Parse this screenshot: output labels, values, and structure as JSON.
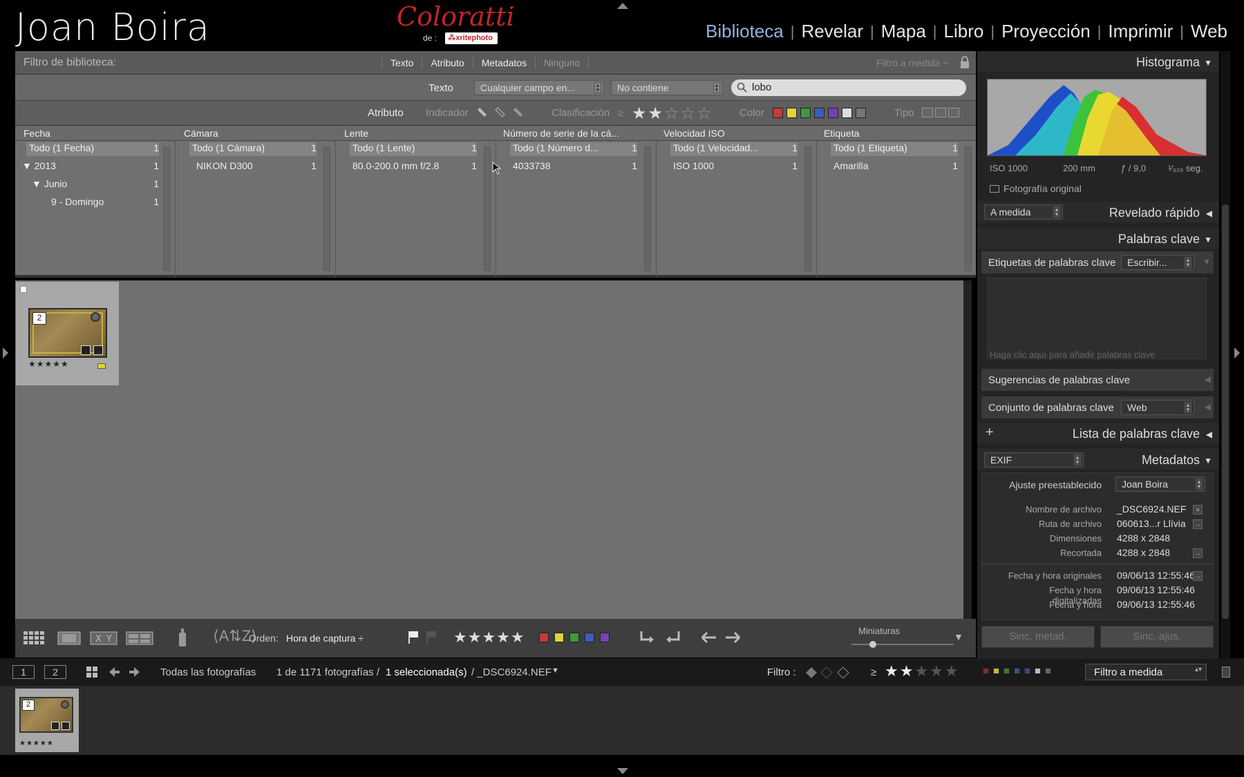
{
  "identity_plate": "Joan Boira",
  "brand": {
    "script": "Coloratti",
    "by": "de :",
    "xrite": "⁂xritephoto"
  },
  "modules": [
    "Biblioteca",
    "Revelar",
    "Mapa",
    "Libro",
    "Proyección",
    "Imprimir",
    "Web"
  ],
  "filter": {
    "title": "Filtro de biblioteca:",
    "tabs": [
      "Texto",
      "Atributo",
      "Metadatos",
      "Ninguno"
    ],
    "custom": "Filtro a medida ÷",
    "text_label": "Texto",
    "field_select": "Cualquier campo en...",
    "rule_select": "No contiene",
    "search_value": "lobo",
    "attr_label": "Atributo",
    "indicator_label": "Indicador",
    "rating_label": "Clasificación",
    "rating_op": "≥",
    "color_label": "Color",
    "type_label": "Tipo",
    "colors": [
      "#c53a3a",
      "#e0d43a",
      "#3c9a3c",
      "#3a5fb8",
      "#7a3fb8",
      "#dddddd",
      "#777777"
    ]
  },
  "columns": [
    {
      "head": "Fecha",
      "rows": [
        {
          "label": "Todo (1 Fecha)",
          "count": "1"
        },
        {
          "label": "▼ 2013",
          "count": "1"
        },
        {
          "label": "▼ Junio",
          "count": "1"
        },
        {
          "label": "9 - Domingo",
          "count": "1"
        }
      ]
    },
    {
      "head": "Cámara",
      "rows": [
        {
          "label": "Todo (1 Cámara)",
          "count": "1"
        },
        {
          "label": "NIKON D300",
          "count": "1"
        }
      ]
    },
    {
      "head": "Lente",
      "rows": [
        {
          "label": "Todo (1 Lente)",
          "count": "1"
        },
        {
          "label": "80.0-200.0 mm f/2.8",
          "count": "1"
        }
      ]
    },
    {
      "head": "Número de serie de la cá...",
      "rows": [
        {
          "label": "Todo (1 Número d...",
          "count": "1"
        },
        {
          "label": "4033738",
          "count": "1"
        }
      ]
    },
    {
      "head": "Velocidad ISO",
      "rows": [
        {
          "label": "Todo (1 Velocidad...",
          "count": "1"
        },
        {
          "label": "ISO 1000",
          "count": "1"
        }
      ]
    },
    {
      "head": "Etiqueta",
      "rows": [
        {
          "label": "Todo (1 Etiqueta)",
          "count": "1"
        },
        {
          "label": "Amarilla",
          "count": "1"
        }
      ]
    }
  ],
  "grid": {
    "thumb_index": "2",
    "stars": "★★★★★"
  },
  "toolbar": {
    "order_label": "Orden:",
    "order_value": "Hora de captura ÷",
    "rating": "★★★★★",
    "thumbs_label": "Miniaturas",
    "colors": [
      "#c53a3a",
      "#e0d43a",
      "#3c9a3c",
      "#3a5fb8",
      "#7a3fb8"
    ]
  },
  "secondary": {
    "btn1": "1",
    "btn2": "2",
    "source": "Todas las fotografías",
    "count_prefix": "1 de 1171 fotografías /",
    "selected": "1 seleccionada(s)",
    "filename": "/ _DSC6924.NEF",
    "filter_label": "Filtro :",
    "rating_op": "≥",
    "filter_select": "Filtro a medida"
  },
  "filmstrip": {
    "thumb_index": "2",
    "stars": "★★★★★"
  },
  "panel": {
    "histogram_title": "Histograma",
    "hist_info": [
      "ISO 1000",
      "200 mm",
      "ƒ / 9,0",
      "¹⁄₃₂₀ seg."
    ],
    "original_photo": "Fotografía original",
    "quick_preset": "A medida",
    "quick_develop": "Revelado rápido",
    "keywording": "Palabras clave",
    "kw_tags_label": "Etiquetas de palabras clave",
    "kw_tags_select": "Escribir...",
    "kw_placeholder": "Haga clic aquí para añadir palabras clave",
    "kw_suggestions": "Sugerencias de palabras clave",
    "kw_set_label": "Conjunto de palabras clave",
    "kw_set_value": "Web",
    "kw_list": "Lista de palabras clave",
    "meta_preset_select": "EXIF",
    "metadata": "Metadatos",
    "preset_label": "Ajuste preestablecido",
    "preset_value": "Joan Boira",
    "meta": [
      {
        "label": "Nombre de archivo",
        "value": "_DSC6924.NEF"
      },
      {
        "label": "Ruta de archivo",
        "value": "060613...r Llívia"
      },
      {
        "label": "Dimensiones",
        "value": "4288 x 2848"
      },
      {
        "label": "Recortada",
        "value": "4288 x 2848"
      },
      {
        "label": "Fecha y hora originales",
        "value": "09/06/13 12:55:46"
      },
      {
        "label": "Fecha y hora digitalizadas",
        "value": "09/06/13 12:55:46"
      },
      {
        "label": "Fecha y hora",
        "value": "09/06/13 12:55:46"
      }
    ],
    "sync_meta": "Sinc. metad.",
    "sync_settings": "Sinc. ajus."
  }
}
